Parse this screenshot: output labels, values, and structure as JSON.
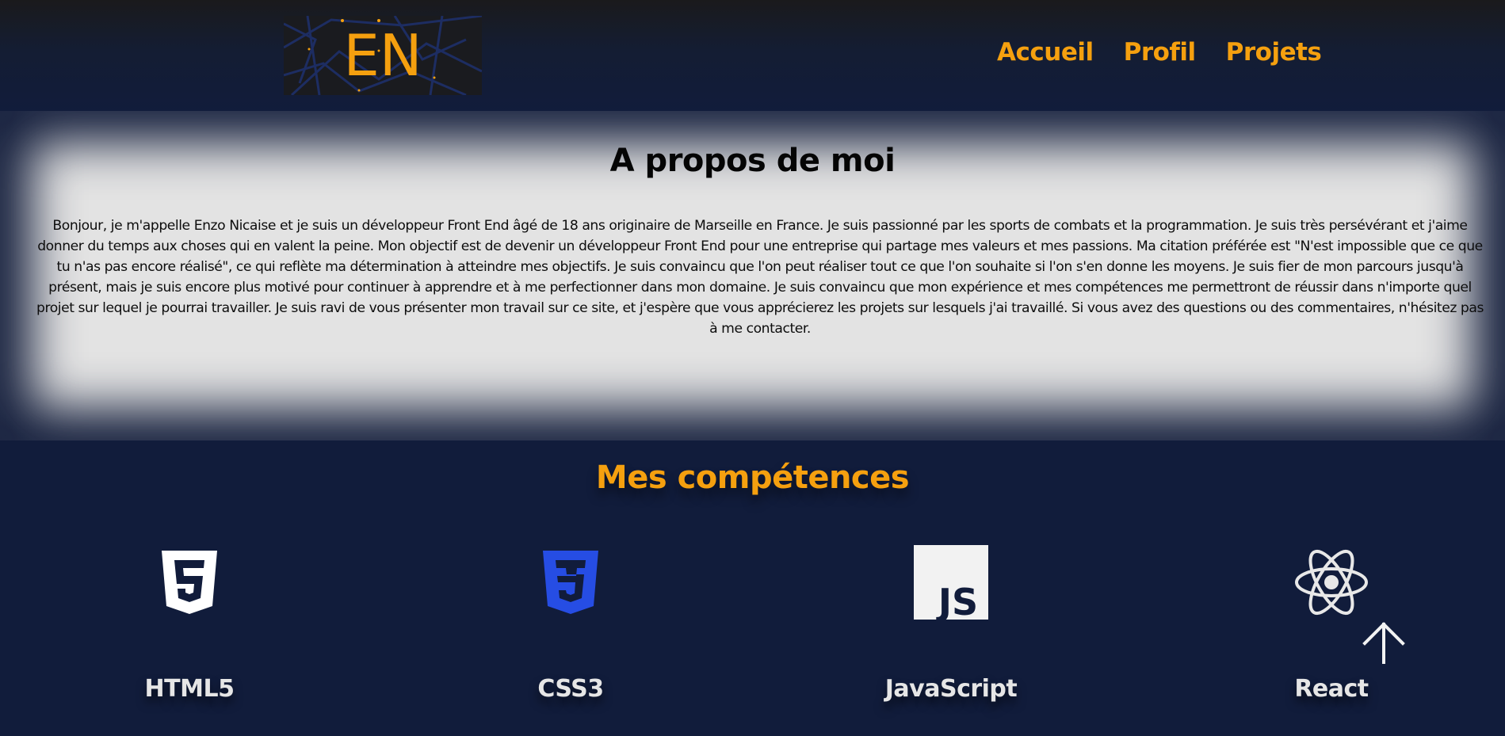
{
  "header": {
    "logo_text": "EN",
    "nav": [
      "Accueil",
      "Profil",
      "Projets"
    ]
  },
  "about": {
    "title": "A propos de moi",
    "text": "Bonjour, je m'appelle Enzo Nicaise et je suis un développeur Front End âgé de 18 ans originaire de Marseille en France. Je suis passionné par les sports de combats et la programmation. Je suis très persévérant et j'aime donner du temps aux choses qui en valent la peine. Mon objectif est de devenir un développeur Front End pour une entreprise qui partage mes valeurs et mes passions. Ma citation préférée est \"N'est impossible que ce que tu n'as pas encore réalisé\", ce qui reflète ma détermination à atteindre mes objectifs. Je suis convaincu que l'on peut réaliser tout ce que l'on souhaite si l'on s'en donne les moyens. Je suis fier de mon parcours jusqu'à présent, mais je suis encore plus motivé pour continuer à apprendre et à me perfectionner dans mon domaine. Je suis convaincu que mon expérience et mes compétences me permettront de réussir dans n'importe quel projet sur lequel je pourrai travailler. Je suis ravi de vous présenter mon travail sur ce site, et j'espère que vous apprécierez les projets sur lesquels j'ai travaillé. Si vous avez des questions ou des commentaires, n'hésitez pas à me contacter."
  },
  "skills": {
    "title": "Mes compétences",
    "items": [
      {
        "label": "HTML5",
        "icon": "html5-icon"
      },
      {
        "label": "CSS3",
        "icon": "css3-icon"
      },
      {
        "label": "JavaScript",
        "icon": "javascript-icon"
      },
      {
        "label": "React",
        "icon": "react-icon"
      }
    ]
  },
  "colors": {
    "accent": "#f5a00f",
    "background": "#111c3b",
    "about_bg": "#e3e3e3",
    "css3_blue": "#264de4"
  }
}
